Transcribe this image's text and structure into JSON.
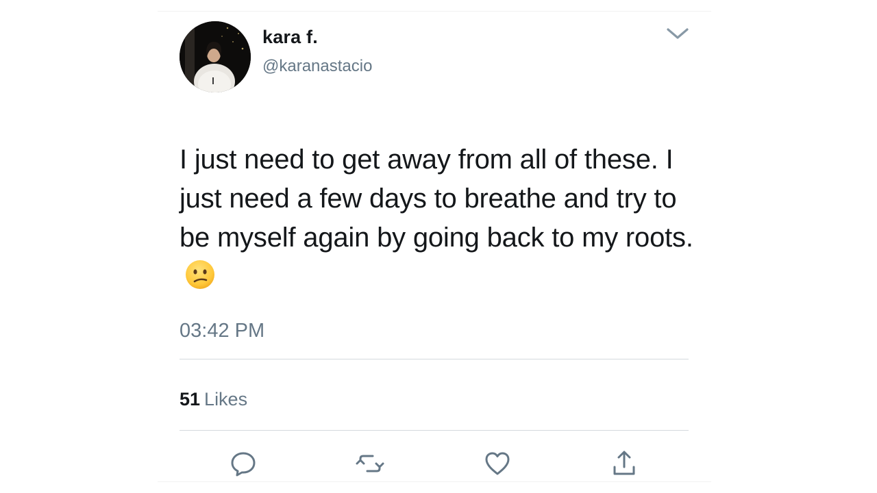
{
  "tweet": {
    "author": {
      "display_name": "kara f.",
      "handle": "@karanastacio"
    },
    "text": "I just need to get away from all of these. I just need a few days to breathe and try to be myself again by going back to my roots.",
    "emoji": "confused-face-emoji",
    "timestamp": "03:42 PM",
    "likes": {
      "count": "51",
      "label": "Likes"
    }
  },
  "icons": {
    "menu": "chevron-down-icon",
    "reply": "reply-icon",
    "retweet": "retweet-icon",
    "like": "heart-icon",
    "share": "share-icon"
  },
  "colors": {
    "primary_text": "#14171a",
    "secondary_text": "#657786",
    "divider": "#d4d9dd",
    "action_icon": "#657786"
  }
}
